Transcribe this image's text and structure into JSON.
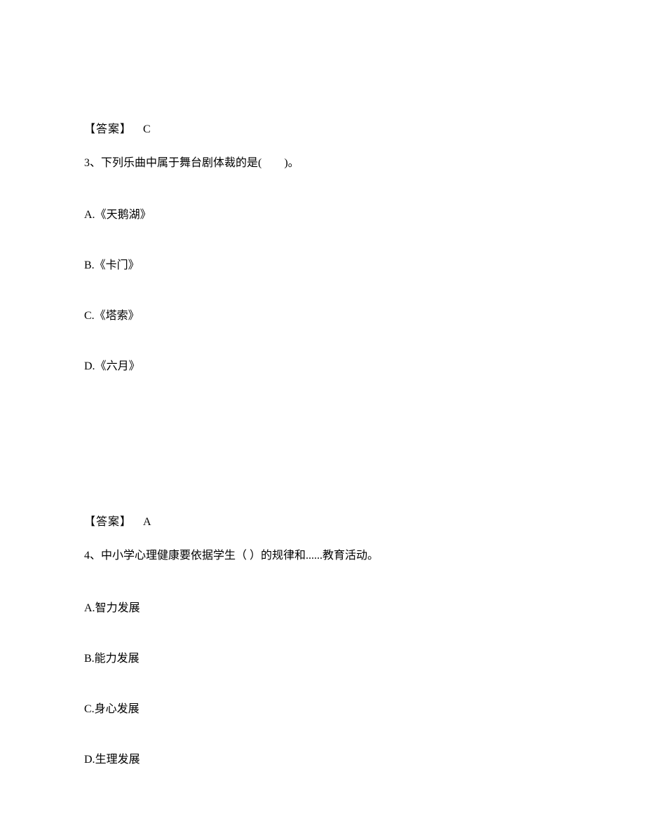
{
  "q2_answer": {
    "label": "【答案】",
    "value": "C"
  },
  "q3": {
    "number": "3、",
    "text": "下列乐曲中属于舞台剧体裁的是(　　)。",
    "options": {
      "a": {
        "letter": "A.",
        "text": "《天鹅湖》"
      },
      "b": {
        "letter": "B.",
        "text": "《卡门》"
      },
      "c": {
        "letter": "C.",
        "text": "《塔索》"
      },
      "d": {
        "letter": "D.",
        "text": "《六月》"
      }
    },
    "answer": {
      "label": "【答案】",
      "value": "A"
    }
  },
  "q4": {
    "number": "4、",
    "text": "中小学心理健康要依据学生（ ）的规律和......教育活动。",
    "options": {
      "a": {
        "letter": "A.",
        "text": "智力发展"
      },
      "b": {
        "letter": "B.",
        "text": "能力发展"
      },
      "c": {
        "letter": "C.",
        "text": "身心发展"
      },
      "d": {
        "letter": "D.",
        "text": "生理发展"
      }
    }
  }
}
